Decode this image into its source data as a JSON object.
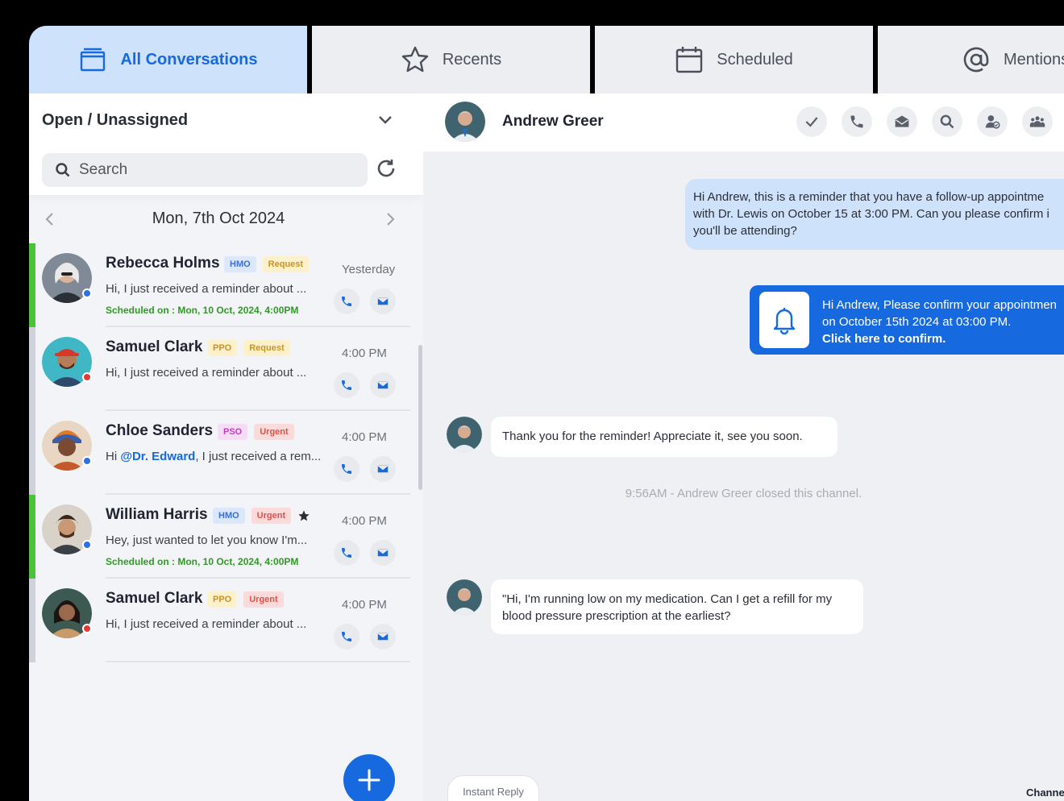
{
  "tabs": [
    {
      "label": "All Conversations",
      "icon": "inbox-icon",
      "active": true
    },
    {
      "label": "Recents",
      "icon": "star-icon",
      "active": false
    },
    {
      "label": "Scheduled",
      "icon": "calendar-icon",
      "active": false
    },
    {
      "label": "Mentions",
      "icon": "at-sign-icon",
      "active": false
    }
  ],
  "filter": {
    "label": "Open / Unassigned"
  },
  "search": {
    "placeholder": "Search"
  },
  "date": {
    "label": "Mon, 7th Oct 2024"
  },
  "conversations": [
    {
      "name": "Rebecca Holms",
      "badges": [
        "HMO",
        "Request"
      ],
      "time": "Yesterday",
      "preview": "Hi, I just received a reminder about ...",
      "scheduled": "Scheduled on : Mon, 10 Oct, 2024, 4:00PM",
      "status_color": "#2f6fe4",
      "highlight": "green"
    },
    {
      "name": "Samuel Clark",
      "badges": [
        "PPO",
        "Request"
      ],
      "time": "4:00 PM",
      "preview": "Hi, I just received a reminder about ...",
      "scheduled": "",
      "status_color": "#e53935",
      "highlight": "grey"
    },
    {
      "name": "Chloe Sanders",
      "badges": [
        "PSO",
        "Urgent"
      ],
      "time": "4:00 PM",
      "preview_prefix": "Hi ",
      "mention": "@Dr. Edward",
      "preview_suffix": ", I just received a rem...",
      "scheduled": "",
      "status_color": "#2f6fe4",
      "highlight": "grey"
    },
    {
      "name": "William Harris",
      "badges": [
        "HMO",
        "Urgent"
      ],
      "starred": true,
      "time": "4:00 PM",
      "preview": "Hey, just wanted to let you know I'm...",
      "scheduled": "Scheduled on : Mon, 10 Oct, 2024, 4:00PM",
      "status_color": "#2f6fe4",
      "highlight": "green"
    },
    {
      "name": "Samuel Clark",
      "badges": [
        "PPO",
        "Urgent"
      ],
      "time": "4:00 PM",
      "preview": "Hi, I just received a reminder about ...",
      "scheduled": "",
      "status_color": "#e53935",
      "highlight": "grey"
    }
  ],
  "chat": {
    "name": "Andrew Greer",
    "header_actions": [
      "check-icon",
      "phone-icon",
      "mail-icon",
      "search-icon",
      "assign-user-icon",
      "group-icon"
    ],
    "messages": {
      "outgoing_1": {
        "lines": [
          "Hi Andrew, this is a reminder that you have a follow-up appointme",
          "with Dr. Lewis on October 15 at 3:00 PM. Can you please confirm i",
          "you'll be attending?"
        ]
      },
      "alert": {
        "lines": [
          "Hi Andrew, Please confirm your appointmen",
          "on October 15th 2024 at 03:00 PM."
        ],
        "cta": "Click here to confirm."
      },
      "incoming_1": {
        "text": "Thank you for the reminder! Appreciate it, see you soon."
      },
      "system": {
        "text": "9:56AM - Andrew Greer closed this channel."
      },
      "incoming_2": {
        "lines": [
          "\"Hi, I'm running low on my medication. Can I get a refill for my",
          "blood pressure prescription at the earliest?"
        ]
      }
    },
    "instant_reply": "Instant Reply",
    "channel_label": "Channe"
  },
  "colors": {
    "accent": "#1769e0",
    "tab_active_bg": "#cfe2fb",
    "scheduled_green": "#2f9a24",
    "highlight_green": "#4cc23a"
  }
}
